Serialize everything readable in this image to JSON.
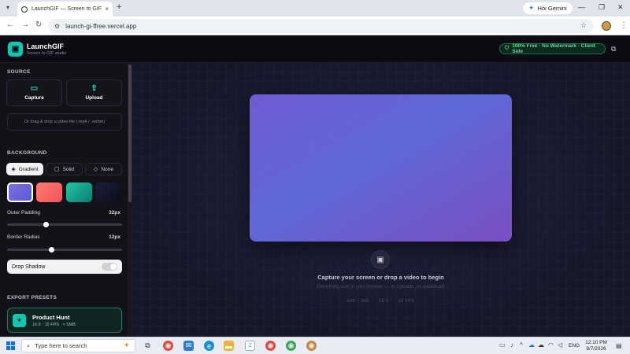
{
  "browser": {
    "tab_title": "LaunchGIF — Screen to GIF Studio",
    "tab_close": "×",
    "new_tab": "+",
    "url": "launch-gi-ffree.vercel.app",
    "gemini_label": "Hỏi Gemini"
  },
  "header": {
    "app_name": "LaunchGIF",
    "tagline": "Screen to GIF studio",
    "badge": "100% Free · No Watermark · Client Side"
  },
  "sidebar": {
    "source": {
      "heading": "SOURCE",
      "capture_label": "Capture",
      "upload_label": "Upload",
      "drop_text": "Or drag & drop a video file (.mp4 / .webm)"
    },
    "background": {
      "heading": "BACKGROUND",
      "modes": [
        "Gradient",
        "Solid",
        "None"
      ],
      "active_mode": "Gradient",
      "swatches": [
        {
          "name": "purple",
          "from": "#7b6fe0",
          "to": "#5a5bd6",
          "selected": true
        },
        {
          "name": "coral",
          "from": "#ff7a6b",
          "to": "#f1555f",
          "selected": false
        },
        {
          "name": "teal",
          "from": "#1fc8a0",
          "to": "#0c7b77",
          "selected": false
        },
        {
          "name": "midnight",
          "from": "#1b1f3a",
          "to": "#0c0d1a",
          "selected": false
        }
      ],
      "outer_padding_label": "Outer Padding",
      "outer_padding_value": "32px",
      "outer_padding_fraction": 0.33,
      "border_radius_label": "Border Radius",
      "border_radius_value": "12px",
      "border_radius_fraction": 0.38,
      "drop_shadow_label": "Drop Shadow",
      "drop_shadow_on": true
    },
    "export": {
      "heading": "EXPORT PRESETS",
      "preset_name": "Product Hunt",
      "preset_meta": "16:9 · 15 FPS · < 5MB"
    }
  },
  "canvas": {
    "title": "Capture your screen or drop a video to begin",
    "subtitle": "Everything runs in your browser — no uploads, no watermark",
    "meta": [
      "640 × 360",
      "16:9",
      "15 FPS"
    ]
  },
  "taskbar": {
    "search_placeholder": "Type here to search",
    "lang": "ENG",
    "time": "12:10 PM",
    "date": "8/7/2026"
  }
}
